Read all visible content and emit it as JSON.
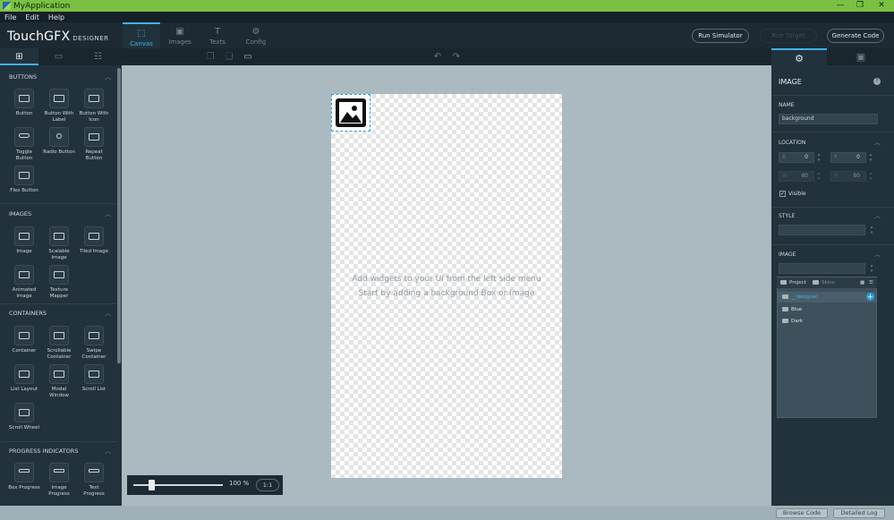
{
  "window": {
    "title": "MyApplication",
    "controls": [
      "—",
      "❐",
      "✕"
    ]
  },
  "menu": [
    "File",
    "Edit",
    "Help"
  ],
  "brand": {
    "name": "TouchGFX",
    "tag": "DESIGNER"
  },
  "main_tabs": [
    {
      "label": "Canvas",
      "icon": "canvas-icon",
      "active": true
    },
    {
      "label": "Images",
      "icon": "image-icon",
      "active": false
    },
    {
      "label": "Texts",
      "icon": "text-icon",
      "active": false
    },
    {
      "label": "Config",
      "icon": "gear-icon",
      "active": false
    }
  ],
  "toolbar": {
    "run_simulator": "Run Simulator",
    "run_target": "Run Target",
    "generate_code": "Generate Code"
  },
  "left_panel": {
    "sections": [
      {
        "title": "BUTTONS",
        "widgets": [
          "Button",
          "Button With Label",
          "Button With Icon",
          "Toggle Button",
          "Radio Button",
          "Repeat Button",
          "Flex Button"
        ]
      },
      {
        "title": "IMAGES",
        "widgets": [
          "Image",
          "Scalable Image",
          "Tiled Image",
          "Animated Image",
          "Texture Mapper"
        ]
      },
      {
        "title": "CONTAINERS",
        "widgets": [
          "Container",
          "Scrollable Container",
          "Swipe Container",
          "List Layout",
          "Modal Window",
          "Scroll List",
          "Scroll Wheel"
        ]
      },
      {
        "title": "PROGRESS INDICATORS",
        "widgets": [
          "Box Progress",
          "Image Progress",
          "Text Progress"
        ]
      }
    ]
  },
  "canvas": {
    "hint_line1": "Add widgets to your UI from the left side menu",
    "hint_line2": "Start by adding a background Box or Image",
    "zoom_label": "100 %",
    "zoom_reset": "1:1",
    "zoom_level": 0.2
  },
  "properties": {
    "header": "IMAGE",
    "name_section": "NAME",
    "name_value": "background",
    "location_section": "LOCATION",
    "x_label": "X",
    "x_value": "0",
    "y_label": "Y",
    "y_value": "0",
    "w_label": "W",
    "w_value": "80",
    "h_label": "H",
    "h_value": "80",
    "visible_label": "Visible",
    "visible_checked": true,
    "style_section": "STYLE",
    "image_section": "IMAGE",
    "dropdown": {
      "tab_project": "Project",
      "tab_skins": "Skins",
      "rows": [
        "__designer",
        "Blue",
        "Dark"
      ]
    }
  },
  "status": {
    "browse_code": "Browse Code",
    "detailed_log": "Detailed Log"
  },
  "colors": {
    "accent": "#3fb3e6",
    "titlebar": "#7ac143",
    "canvas_bg": "#abbac1"
  }
}
